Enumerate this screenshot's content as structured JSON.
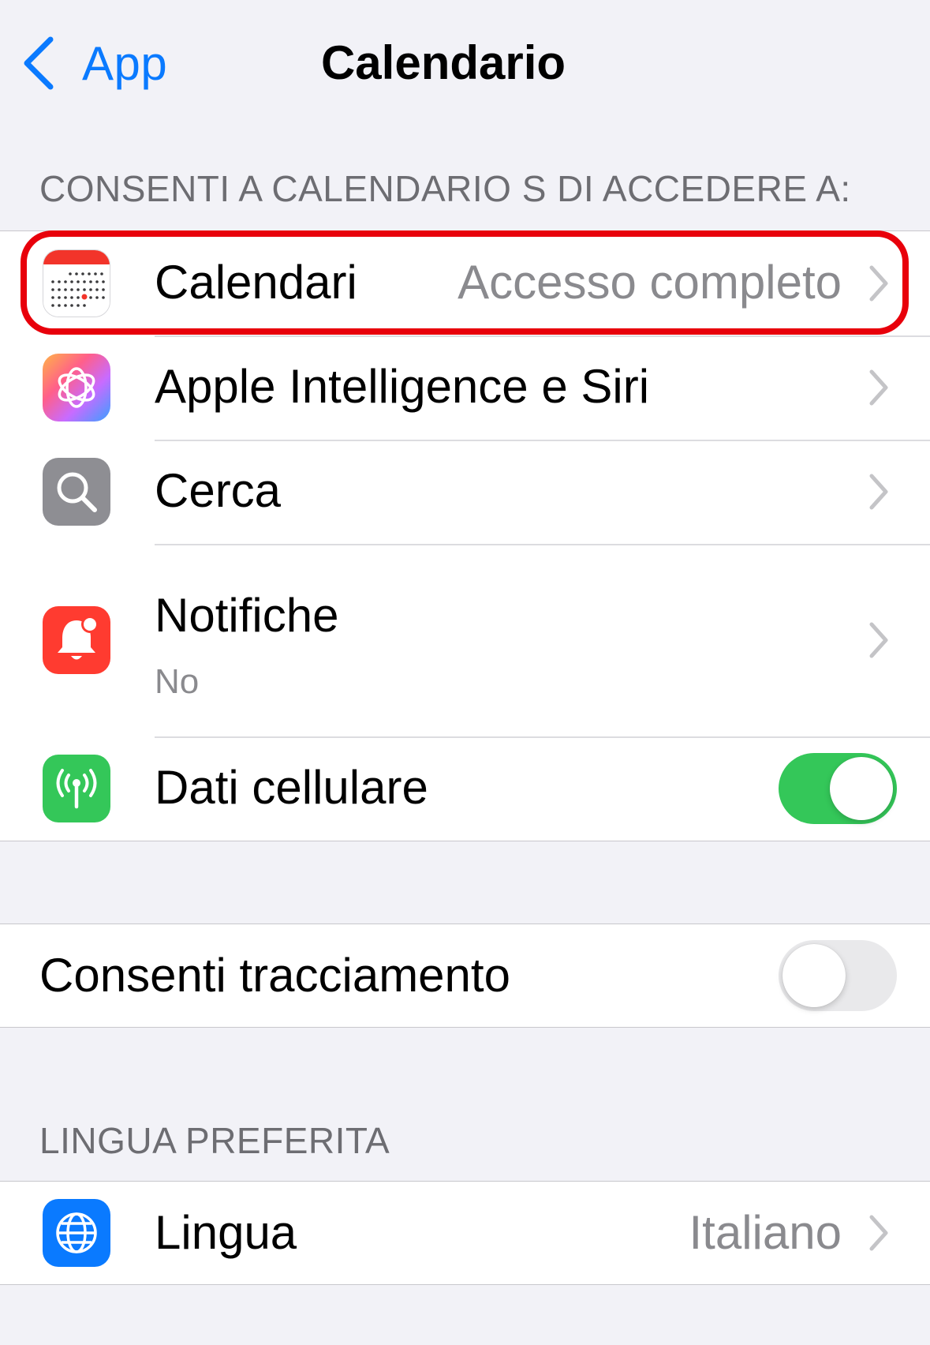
{
  "nav": {
    "back_label": "App",
    "title": "Calendario"
  },
  "section_access": {
    "header": "CONSENTI A CALENDARIO S DI ACCEDERE A:",
    "rows": [
      {
        "label": "Calendari",
        "value": "Accesso completo",
        "icon": "calendar-icon"
      },
      {
        "label": "Apple Intelligence e Siri",
        "icon": "apple-intelligence-icon"
      },
      {
        "label": "Cerca",
        "icon": "search-icon"
      },
      {
        "label": "Notifiche",
        "sublabel": "No",
        "icon": "notification-bell-icon"
      },
      {
        "label": "Dati cellulare",
        "icon": "cellular-antenna-icon",
        "toggle": "on"
      }
    ]
  },
  "tracking": {
    "label": "Consenti tracciamento",
    "toggle": "off"
  },
  "section_language": {
    "header": "LINGUA PREFERITA",
    "rows": [
      {
        "label": "Lingua",
        "value": "Italiano",
        "icon": "globe-icon"
      }
    ]
  },
  "colors": {
    "accent": "#0a7aff",
    "toggle_on": "#34c759",
    "highlight": "#e8000b",
    "background": "#f2f2f7"
  }
}
